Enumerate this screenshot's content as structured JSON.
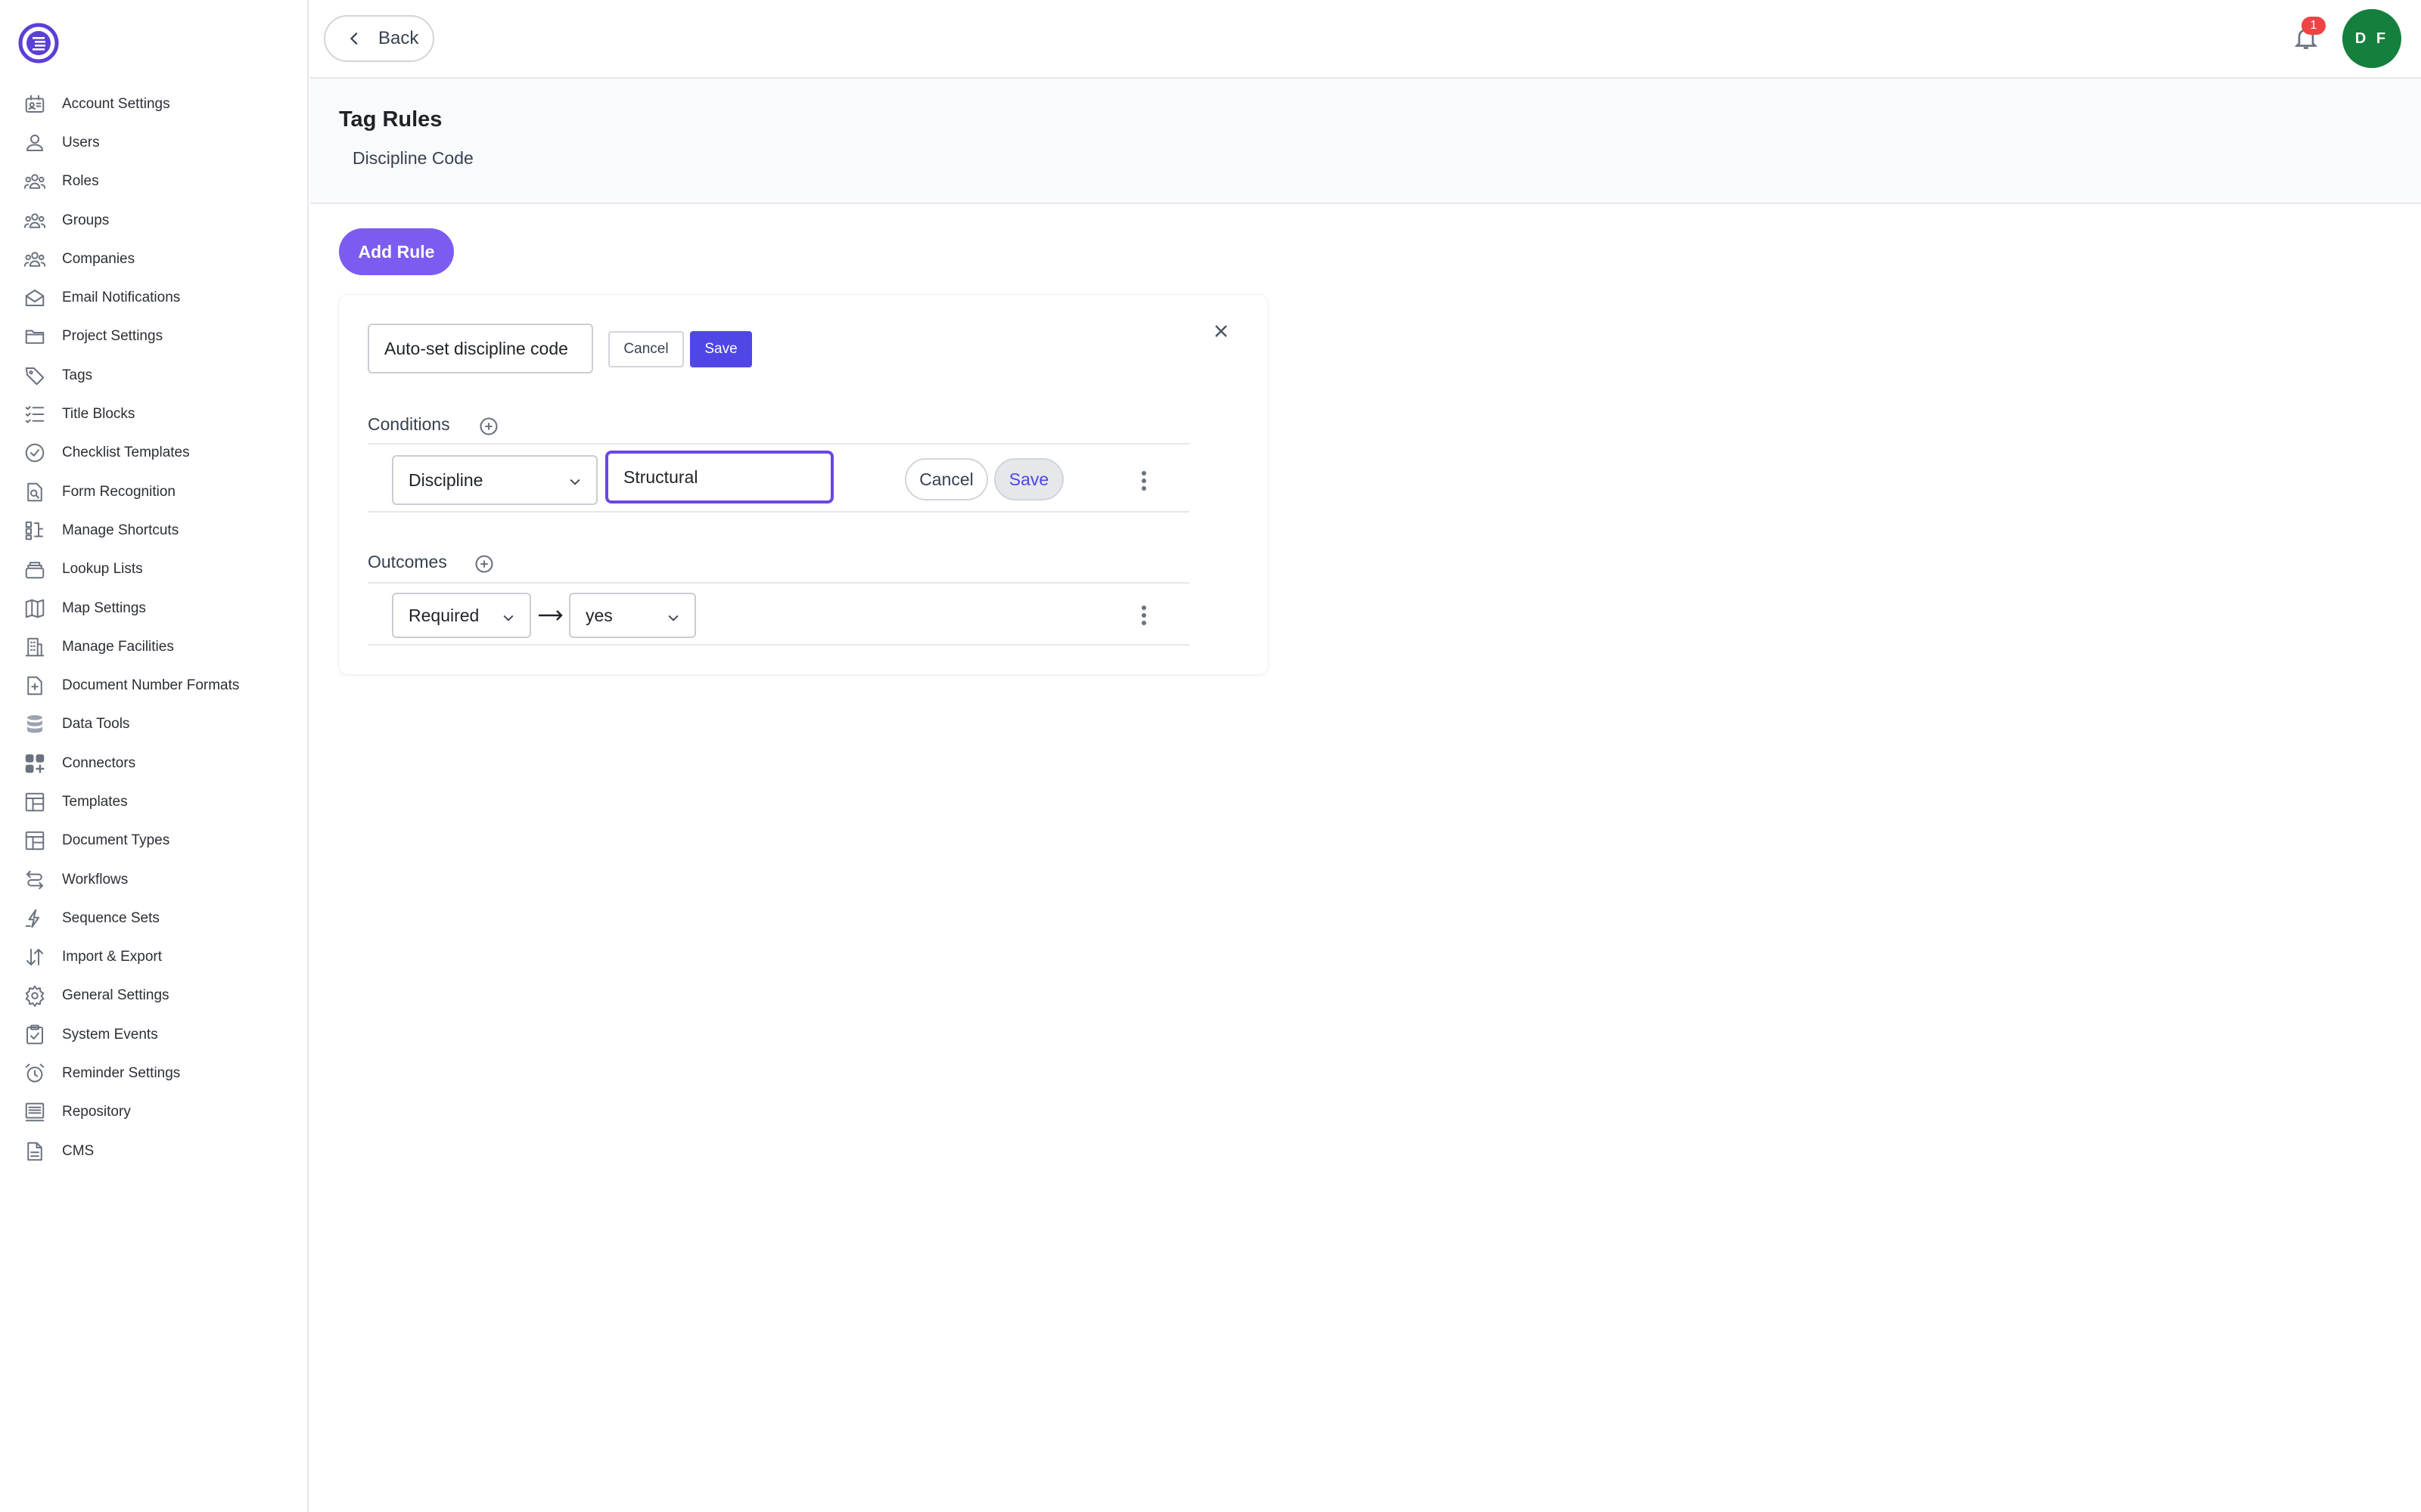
{
  "sidebar": {
    "logo_icon": "app-logo-icon",
    "items": [
      {
        "label": "Account Settings",
        "icon": "account-settings-icon"
      },
      {
        "label": "Users",
        "icon": "user-icon"
      },
      {
        "label": "Roles",
        "icon": "roles-icon"
      },
      {
        "label": "Groups",
        "icon": "groups-icon"
      },
      {
        "label": "Companies",
        "icon": "companies-icon"
      },
      {
        "label": "Email Notifications",
        "icon": "email-icon"
      },
      {
        "label": "Project Settings",
        "icon": "folder-icon"
      },
      {
        "label": "Tags",
        "icon": "tag-icon"
      },
      {
        "label": "Title Blocks",
        "icon": "checklist-lines-icon"
      },
      {
        "label": "Checklist Templates",
        "icon": "check-circle-icon"
      },
      {
        "label": "Form Recognition",
        "icon": "document-search-icon"
      },
      {
        "label": "Manage Shortcuts",
        "icon": "shortcuts-icon"
      },
      {
        "label": "Lookup Lists",
        "icon": "stack-icon"
      },
      {
        "label": "Map Settings",
        "icon": "map-icon"
      },
      {
        "label": "Manage Facilities",
        "icon": "building-icon"
      },
      {
        "label": "Document Number Formats",
        "icon": "document-plus-icon"
      },
      {
        "label": "Data Tools",
        "icon": "database-icon"
      },
      {
        "label": "Connectors",
        "icon": "connectors-icon"
      },
      {
        "label": "Templates",
        "icon": "template-icon"
      },
      {
        "label": "Document Types",
        "icon": "document-types-icon"
      },
      {
        "label": "Workflows",
        "icon": "workflow-icon"
      },
      {
        "label": "Sequence Sets",
        "icon": "sequence-icon"
      },
      {
        "label": "Import & Export",
        "icon": "import-export-icon"
      },
      {
        "label": "General Settings",
        "icon": "gear-icon"
      },
      {
        "label": "System Events",
        "icon": "clipboard-check-icon"
      },
      {
        "label": "Reminder Settings",
        "icon": "alarm-clock-icon"
      },
      {
        "label": "Repository",
        "icon": "repository-icon"
      },
      {
        "label": "CMS",
        "icon": "file-text-icon"
      }
    ]
  },
  "topbar": {
    "back_label": "Back",
    "notification_count": "1",
    "avatar_initials": "D F"
  },
  "header": {
    "title": "Tag Rules",
    "subtitle": "Discipline Code"
  },
  "main": {
    "add_rule_label": "Add Rule",
    "rule": {
      "name_value": "Auto-set discipline code",
      "cancel_label": "Cancel",
      "save_label": "Save",
      "conditions_label": "Conditions",
      "condition": {
        "field": "Discipline",
        "value": "Structural",
        "cancel_label": "Cancel",
        "save_label": "Save"
      },
      "outcomes_label": "Outcomes",
      "outcome": {
        "field": "Required",
        "value": "yes"
      }
    }
  },
  "colors": {
    "accent": "#7c5cf0",
    "primary_button": "#4f46e5",
    "avatar": "#15803d",
    "badge": "#ef4444"
  }
}
